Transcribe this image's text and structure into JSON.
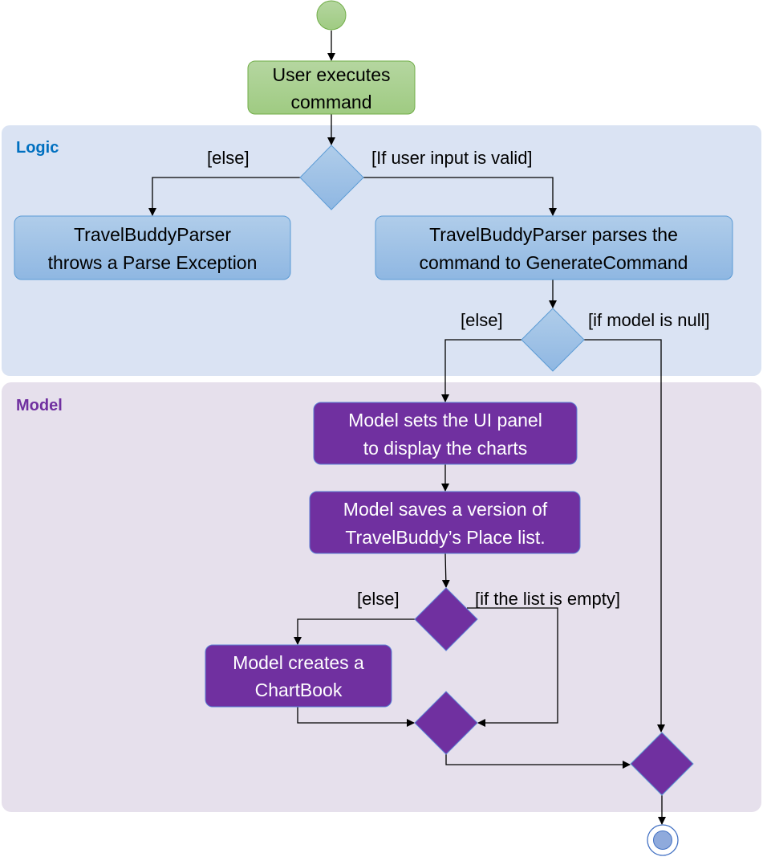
{
  "swimlanes": {
    "logic": {
      "label": "Logic",
      "color": "#dae3f3",
      "label_color": "#0070c0"
    },
    "model": {
      "label": "Model",
      "color": "#e6e0ec",
      "label_color": "#7030a0"
    }
  },
  "nodes": {
    "start": {
      "type": "initial"
    },
    "user_executes": {
      "lines": [
        "User executes",
        "command"
      ],
      "color": "#a9d18e"
    },
    "parse_exception": {
      "lines": [
        "TravelBuddyParser",
        "throws a Parse Exception"
      ],
      "color": "#9dc3e6"
    },
    "parse_command": {
      "lines": [
        "TravelBuddyParser parses the",
        "command to GenerateCommand"
      ],
      "color": "#9dc3e6"
    },
    "set_panel": {
      "lines": [
        "Model sets the UI panel",
        "to display the charts"
      ],
      "color": "#7030a0"
    },
    "save_version": {
      "lines": [
        "Model saves a version of",
        "TravelBuddy’s Place list."
      ],
      "color": "#7030a0"
    },
    "create_chartbook": {
      "lines": [
        "Model creates a",
        "ChartBook"
      ],
      "color": "#7030a0"
    },
    "end": {
      "type": "final"
    }
  },
  "guards": {
    "d1_left": "[else]",
    "d1_right": "[If user input is valid]",
    "d2_left": "[else]",
    "d2_right": "[if model is null]",
    "d3_left": "[else]",
    "d3_right": "[if the list is empty]"
  }
}
